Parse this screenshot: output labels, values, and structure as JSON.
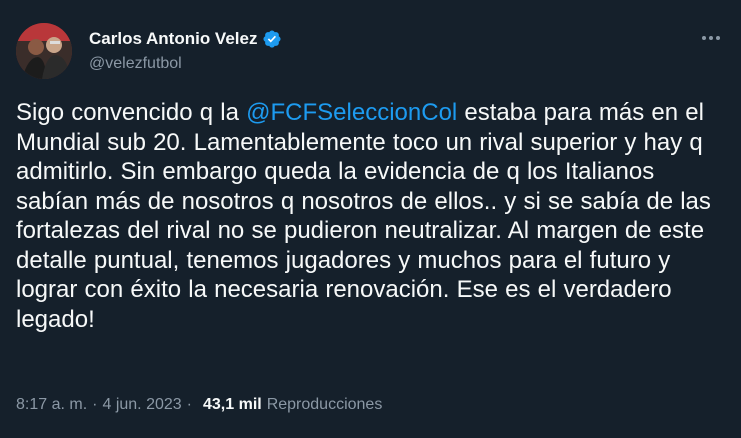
{
  "author": {
    "display_name": "Carlos Antonio Velez",
    "handle": "@velezfutbol",
    "verified": true
  },
  "tweet": {
    "text_before": "Sigo convencido q la ",
    "mention": "@FCFSeleccionCol",
    "text_after": " estaba para más en el Mundial sub 20. Lamentablemente toco un rival superior y hay q admitirlo. Sin embargo queda la evidencia de q los Italianos sabían más de nosotros q nosotros de ellos.. y si se sabía de las fortalezas del rival no se pudieron neutralizar. Al margen de este detalle puntual, tenemos jugadores y muchos para el futuro y lograr con éxito la necesaria renovación. Ese es el verdadero legado!"
  },
  "meta": {
    "time": "8:17 a. m.",
    "separator": "·",
    "date": "4 jun. 2023",
    "views_count": "43,1 mil",
    "views_label": "Reproducciones"
  },
  "colors": {
    "background": "#15202b",
    "text": "#f7f9f9",
    "secondary": "#8b98a5",
    "accent": "#1d9bf0"
  },
  "icons": {
    "verified": "verified-badge-icon",
    "more": "more-options-icon"
  }
}
